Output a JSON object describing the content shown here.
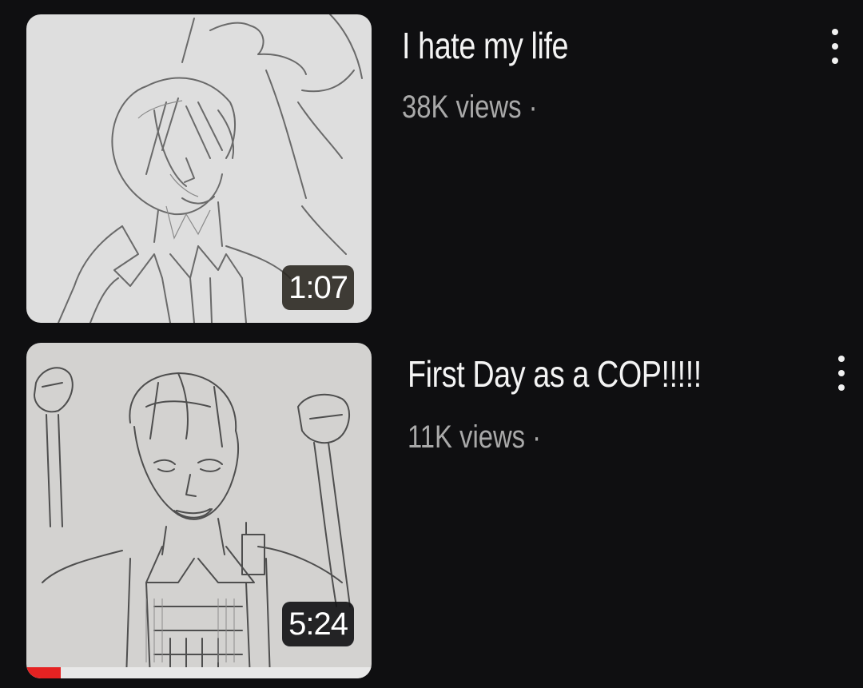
{
  "videos": [
    {
      "title": "I hate my life",
      "meta": "38K views ·",
      "duration": "1:07",
      "thumbnail_icon": "pencil-sketch-man-waving",
      "watch_progress": 0
    },
    {
      "title": "First Day as a COP!!!!!",
      "meta": "11K views ·",
      "duration": "5:24",
      "thumbnail_icon": "pencil-sketch-man-cheering",
      "watch_progress": 0.1
    }
  ],
  "more_icon": "vertical-ellipsis-icon",
  "colors": {
    "background": "#0f0f11",
    "title": "#f4f4f4",
    "meta": "#a9a9a9",
    "progress": "#e52222"
  }
}
